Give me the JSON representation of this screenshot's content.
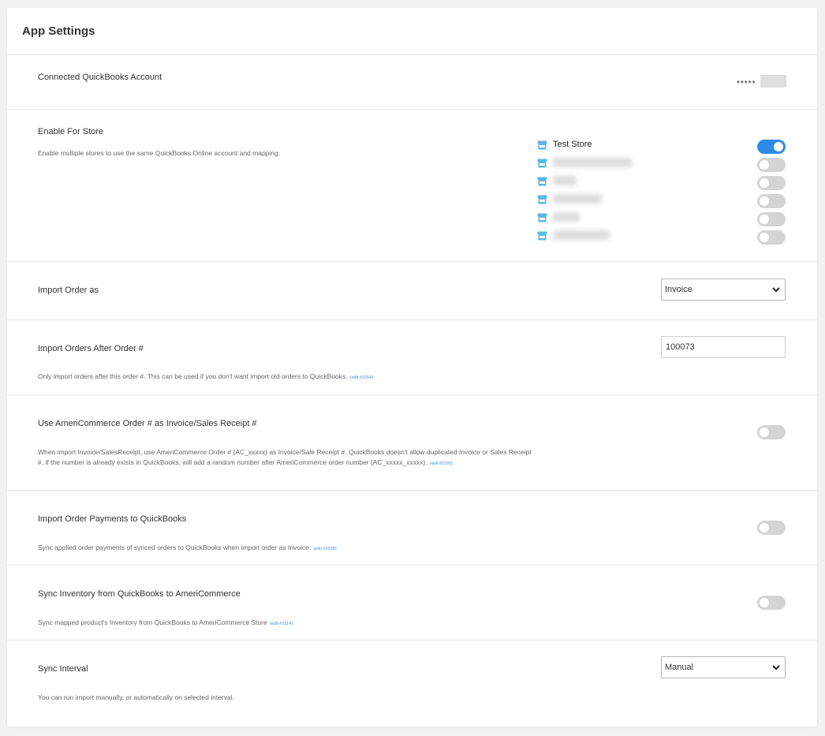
{
  "header": {
    "title": "App Settings"
  },
  "connected_account": {
    "label": "Connected QuickBooks Account",
    "masked_value": "*****"
  },
  "enable_for_store": {
    "label": "Enable For Store",
    "description": "Enable multiple stores to use the same QuickBooks Online account and mapping.",
    "stores": [
      {
        "name": "Test Store",
        "enabled": true,
        "redacted": false
      },
      {
        "name": "",
        "enabled": false,
        "redacted": true
      },
      {
        "name": "",
        "enabled": false,
        "redacted": true
      },
      {
        "name": "",
        "enabled": false,
        "redacted": true
      },
      {
        "name": "",
        "enabled": false,
        "redacted": true
      },
      {
        "name": "",
        "enabled": false,
        "redacted": true
      }
    ]
  },
  "import_order_as": {
    "label": "Import Order as",
    "selected": "Invoice"
  },
  "import_after_order": {
    "label": "Import Orders After Order #",
    "value": "100073",
    "description": "Only import orders after this order #. This can be used if you don't want import old orders to QuickBooks.",
    "edit_link": "(edit #2254)"
  },
  "use_order_number": {
    "label": "Use AmeriCommerce Order # as Invoice/Sales Receipt #",
    "enabled": false,
    "description": "When import Invoice/SalesReceipt, use AmeriCommerce Order # (AC_xxxxx) as Invoice/Sale Receipt #. QuickBooks doesn't allow duplicated Invoice or Sales Receipt #, if the number is already exists in QuickBooks, will add a random number after AmeriCommerce order number (AC_xxxxx_xxxxx).",
    "edit_link": "(edit #2226)"
  },
  "import_payments": {
    "label": "Import Order Payments to QuickBooks",
    "enabled": false,
    "description": "Sync applied order payments of synced orders to QuickBooks when import order as Invoice.",
    "edit_link": "(edit #2228)"
  },
  "sync_inventory": {
    "label": "Sync Inventory from QuickBooks to AmeriCommerce",
    "enabled": false,
    "description": "Sync mapped product's Inventory from QuickBooks to AmeriCommerce Store",
    "edit_link": "(edit #2214)"
  },
  "sync_interval": {
    "label": "Sync Interval",
    "selected": "Manual",
    "description": "You can run import manually, or automatically on selected interval."
  },
  "colors": {
    "accent": "#2f8ae5",
    "store_icon": "#5bb8e0",
    "toggle_off": "#d4d4d4"
  }
}
